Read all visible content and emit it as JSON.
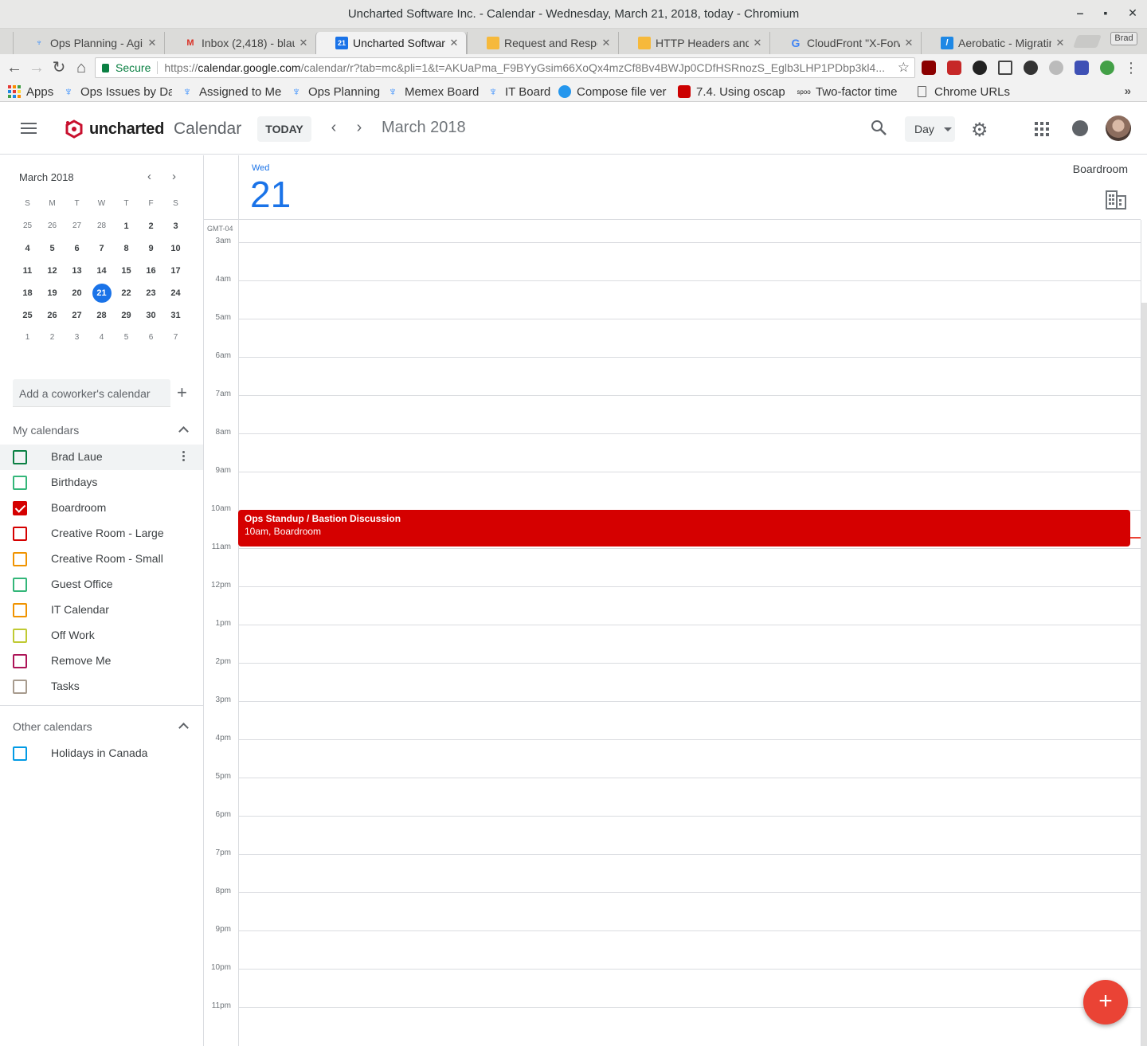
{
  "window": {
    "title": "Uncharted Software Inc. - Calendar - Wednesday, March 21, 2018, today - Chromium",
    "minimize": "‒",
    "maximize": "▪",
    "close": "✕"
  },
  "tabs": [
    {
      "label": "Ops Planning - Agile",
      "icon": "jira-icon"
    },
    {
      "label": "Inbox (2,418) - blau",
      "icon": "gmail-icon"
    },
    {
      "label": "Uncharted Software",
      "icon": "calendar-icon",
      "active": true
    },
    {
      "label": "Request and Respon",
      "icon": "doc-icon"
    },
    {
      "label": "HTTP Headers and C",
      "icon": "doc-icon"
    },
    {
      "label": "CloudFront \"X-Forw",
      "icon": "google-icon"
    },
    {
      "label": "Aerobatic - Migratin",
      "icon": "aerobatic-icon"
    }
  ],
  "profile_chip": "Brad",
  "omnibox": {
    "secure_label": "Secure",
    "url_scheme": "https://",
    "url_host": "calendar.google.com",
    "url_path": "/calendar/r?tab=mc&pli=1&t=AKUaPma_F9BYyGsim66XoQx4mzCf8Bv4BWJp0CDfHSRnozS_Eglb3LHP1PDbp3kl4..."
  },
  "bookmarks": [
    {
      "label": "Apps",
      "icon": "apps-icon"
    },
    {
      "label": "Ops Issues by Da",
      "icon": "jira-icon"
    },
    {
      "label": "Assigned to Me",
      "icon": "jira-icon"
    },
    {
      "label": "Ops Planning",
      "icon": "jira-icon"
    },
    {
      "label": "Memex Board",
      "icon": "jira-icon"
    },
    {
      "label": "IT Board",
      "icon": "jira-icon"
    },
    {
      "label": "Compose file ver",
      "icon": "docker-icon"
    },
    {
      "label": "7.4. Using oscap",
      "icon": "redhat-icon"
    },
    {
      "label": "Two-factor time",
      "icon": "spoo-icon"
    },
    {
      "label": "Chrome URLs",
      "icon": "page-icon"
    }
  ],
  "bookmarks_more": "»",
  "header": {
    "brand": "uncharted",
    "product": "Calendar",
    "today_label": "TODAY",
    "prev": "‹",
    "next": "›",
    "period": "March 2018",
    "view_label": "Day"
  },
  "mini_calendar": {
    "title": "March 2018",
    "prev": "‹",
    "next": "›",
    "weekdays": [
      "S",
      "M",
      "T",
      "W",
      "T",
      "F",
      "S"
    ],
    "weeks": [
      [
        "25",
        "26",
        "27",
        "28",
        "1",
        "2",
        "3"
      ],
      [
        "4",
        "5",
        "6",
        "7",
        "8",
        "9",
        "10"
      ],
      [
        "11",
        "12",
        "13",
        "14",
        "15",
        "16",
        "17"
      ],
      [
        "18",
        "19",
        "20",
        "21",
        "22",
        "23",
        "24"
      ],
      [
        "25",
        "26",
        "27",
        "28",
        "29",
        "30",
        "31"
      ],
      [
        "1",
        "2",
        "3",
        "4",
        "5",
        "6",
        "7"
      ]
    ],
    "today": "21"
  },
  "coworker": {
    "placeholder": "Add a coworker's calendar",
    "add": "+"
  },
  "my_calendars": {
    "title": "My calendars",
    "items": [
      {
        "label": "Brad Laue",
        "color": "#0b8043",
        "checked": false
      },
      {
        "label": "Birthdays",
        "color": "#33b679",
        "checked": false
      },
      {
        "label": "Boardroom",
        "color": "#d50000",
        "checked": true
      },
      {
        "label": "Creative Room - Large",
        "color": "#d50000",
        "checked": false
      },
      {
        "label": "Creative Room - Small",
        "color": "#f09300",
        "checked": false
      },
      {
        "label": "Guest Office",
        "color": "#33b679",
        "checked": false
      },
      {
        "label": "IT Calendar",
        "color": "#f09300",
        "checked": false
      },
      {
        "label": "Off Work",
        "color": "#c0ca33",
        "checked": false
      },
      {
        "label": "Remove Me",
        "color": "#ad1457",
        "checked": false
      },
      {
        "label": "Tasks",
        "color": "#a79b8e",
        "checked": false
      }
    ]
  },
  "other_calendars": {
    "title": "Other calendars",
    "items": [
      {
        "label": "Holidays in Canada",
        "color": "#039be5",
        "checked": false
      }
    ]
  },
  "day_view": {
    "weekday": "Wed",
    "day": "21",
    "resource": "Boardroom",
    "timezone": "GMT-04",
    "hours": [
      "3am",
      "4am",
      "5am",
      "6am",
      "7am",
      "8am",
      "9am",
      "10am",
      "11am",
      "12pm",
      "1pm",
      "2pm",
      "3pm",
      "4pm",
      "5pm",
      "6pm",
      "7pm",
      "8pm",
      "9pm",
      "10pm",
      "11pm"
    ]
  },
  "event": {
    "title": "Ops Standup / Bastion Discussion",
    "time_location": "10am, Boardroom",
    "color": "#d50000"
  },
  "fab_label": "+"
}
